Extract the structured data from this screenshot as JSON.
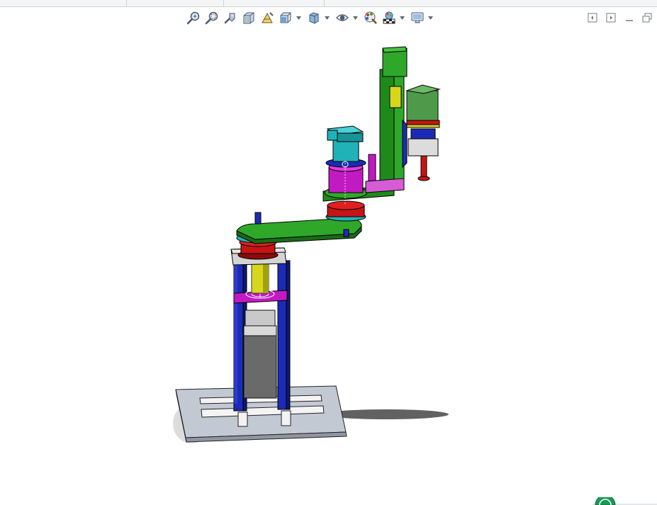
{
  "window": {
    "background": "#ffffff",
    "strip_color": "#f4f5f7"
  },
  "heads_up_toolbar": {
    "tools": [
      {
        "id": "zoom-to-fit",
        "icon": "zoom-to-fit-icon"
      },
      {
        "id": "zoom-to-area",
        "icon": "zoom-to-area-icon"
      },
      {
        "id": "previous-view",
        "icon": "previous-view-icon"
      },
      {
        "id": "section-view",
        "icon": "section-view-icon"
      },
      {
        "id": "dynamic-annotation-views",
        "icon": "annotation-views-icon"
      },
      {
        "id": "view-orientation",
        "icon": "view-orientation-icon",
        "dropdown": true
      },
      {
        "id": "display-style",
        "icon": "display-style-icon",
        "dropdown": true
      },
      {
        "id": "hide-show-items",
        "icon": "eye-icon",
        "dropdown": true
      },
      {
        "id": "edit-appearance",
        "icon": "edit-appearance-icon"
      },
      {
        "id": "apply-scene",
        "icon": "apply-scene-icon",
        "dropdown": true
      },
      {
        "id": "view-settings",
        "icon": "monitor-icon",
        "dropdown": true
      }
    ]
  },
  "window_controls": [
    "tile-left-icon",
    "tile-right-icon",
    "minimize-icon",
    "restore-icon"
  ],
  "model": {
    "description_colors": {
      "base_plate": "#b7bdc6",
      "frame": "#1c2bb5",
      "motor_red": "#c81414",
      "arm_green": "#1f8a1a",
      "joint_magenta": "#c21ac2",
      "cap_cyan": "#1fb3b8",
      "motor_box": "#4f9a4a",
      "slider_yellow": "#d8d61c",
      "motor_grey": "#6a6a6a"
    }
  }
}
